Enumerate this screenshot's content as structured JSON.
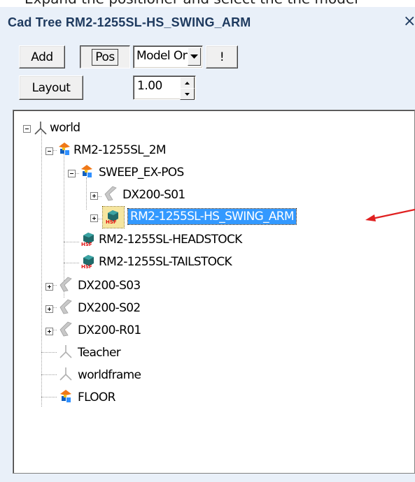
{
  "caption": "Expand the positioner and select the the model",
  "window": {
    "title": "Cad Tree RM2-1255SL-HS_SWING_ARM",
    "close_glyph": "×"
  },
  "toolbar": {
    "add_label": "Add",
    "pos_label": "Pos",
    "mode_value": "Model Only",
    "bang_label": "!",
    "layout_label": "Layout",
    "scale_value": "1.00"
  },
  "tree": {
    "world": "world",
    "rm2_2m": "RM2-1255SL_2M",
    "sweep": "SWEEP_EX-POS",
    "dx_s01": "DX200-S01",
    "swing_arm": "RM2-1255SL-HS_SWING_ARM",
    "headstock": "RM2-1255SL-HEADSTOCK",
    "tailstock": "RM2-1255SL-TAILSTOCK",
    "dx_s03": "DX200-S03",
    "dx_s02": "DX200-S02",
    "dx_r01": "DX200-R01",
    "teacher": "Teacher",
    "worldframe": "worldframe",
    "floor": "FLOOR"
  },
  "colors": {
    "selection": "#3399ff",
    "arrow": "#e02020",
    "title": "#1e3a5f"
  },
  "icons": {
    "frame": "frame-axis-icon",
    "assembly": "assembly-icon",
    "robot": "robot-arm-icon",
    "part": "part-icon"
  }
}
